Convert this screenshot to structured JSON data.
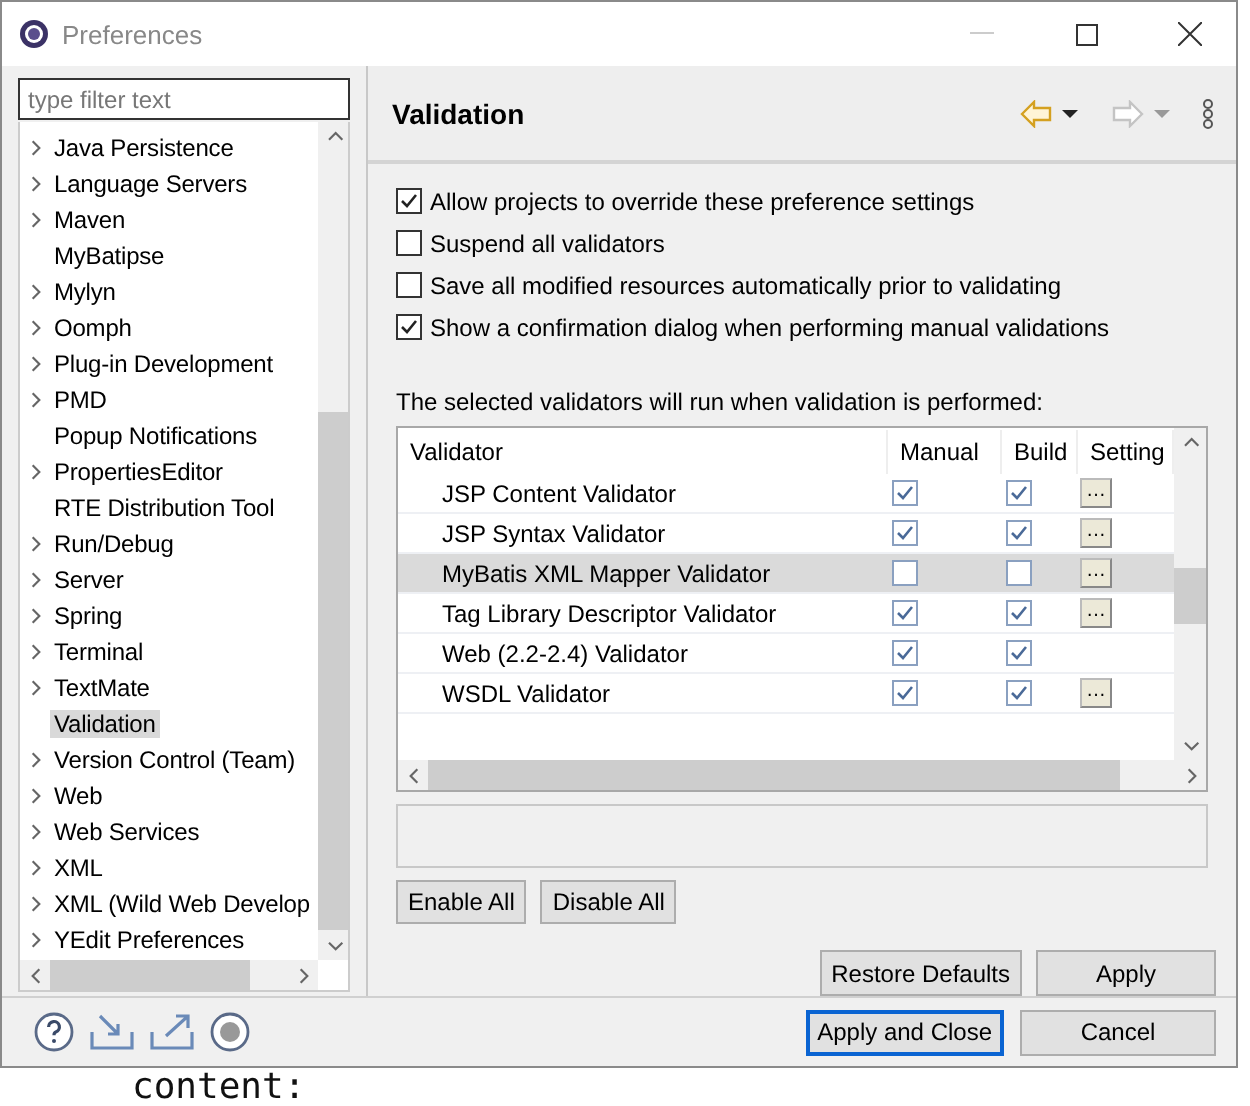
{
  "window": {
    "title": "Preferences"
  },
  "filter": {
    "placeholder": "type filter text"
  },
  "tree": {
    "items": [
      {
        "label": "Java Persistence",
        "expandable": true,
        "selected": false
      },
      {
        "label": "Language Servers",
        "expandable": true,
        "selected": false
      },
      {
        "label": "Maven",
        "expandable": true,
        "selected": false
      },
      {
        "label": "MyBatipse",
        "expandable": false,
        "selected": false
      },
      {
        "label": "Mylyn",
        "expandable": true,
        "selected": false
      },
      {
        "label": "Oomph",
        "expandable": true,
        "selected": false
      },
      {
        "label": "Plug-in Development",
        "expandable": true,
        "selected": false
      },
      {
        "label": "PMD",
        "expandable": true,
        "selected": false
      },
      {
        "label": "Popup Notifications",
        "expandable": false,
        "selected": false
      },
      {
        "label": "PropertiesEditor",
        "expandable": true,
        "selected": false
      },
      {
        "label": "RTE Distribution Tool",
        "expandable": false,
        "selected": false
      },
      {
        "label": "Run/Debug",
        "expandable": true,
        "selected": false
      },
      {
        "label": "Server",
        "expandable": true,
        "selected": false
      },
      {
        "label": "Spring",
        "expandable": true,
        "selected": false
      },
      {
        "label": "Terminal",
        "expandable": true,
        "selected": false
      },
      {
        "label": "TextMate",
        "expandable": true,
        "selected": false
      },
      {
        "label": "Validation",
        "expandable": false,
        "selected": true
      },
      {
        "label": "Version Control (Team)",
        "expandable": true,
        "selected": false
      },
      {
        "label": "Web",
        "expandable": true,
        "selected": false
      },
      {
        "label": "Web Services",
        "expandable": true,
        "selected": false
      },
      {
        "label": "XML",
        "expandable": true,
        "selected": false
      },
      {
        "label": "XML (Wild Web Develop",
        "expandable": true,
        "selected": false
      },
      {
        "label": "YEdit Preferences",
        "expandable": true,
        "selected": false
      }
    ]
  },
  "page": {
    "title": "Validation",
    "options": [
      {
        "label": "Allow projects to override these preference settings",
        "checked": true
      },
      {
        "label": "Suspend all validators",
        "checked": false
      },
      {
        "label": "Save all modified resources automatically prior to validating",
        "checked": false
      },
      {
        "label": "Show a confirmation dialog when performing manual validations",
        "checked": true
      }
    ],
    "caption": "The selected validators will run when validation is performed:",
    "table": {
      "columns": [
        "Validator",
        "Manual",
        "Build",
        "Setting"
      ],
      "rows": [
        {
          "name": "JSP Content Validator",
          "manual": true,
          "build": true,
          "settings": "…",
          "selected": false
        },
        {
          "name": "JSP Syntax Validator",
          "manual": true,
          "build": true,
          "settings": "…",
          "selected": false
        },
        {
          "name": "MyBatis XML Mapper Validator",
          "manual": false,
          "build": false,
          "settings": "…",
          "selected": true
        },
        {
          "name": "Tag Library Descriptor Validator",
          "manual": true,
          "build": true,
          "settings": "…",
          "selected": false
        },
        {
          "name": "Web (2.2-2.4) Validator",
          "manual": true,
          "build": true,
          "selected": false
        },
        {
          "name": "WSDL Validator",
          "manual": true,
          "build": true,
          "settings": "…",
          "selected": false
        }
      ]
    },
    "list_buttons": [
      "Enable All",
      "Disable All"
    ],
    "page_buttons": [
      "Restore Defaults",
      "Apply"
    ]
  },
  "footer_buttons": [
    {
      "label": "Apply and Close",
      "default": true
    },
    {
      "label": "Cancel",
      "default": false
    }
  ],
  "background_text": "content:"
}
